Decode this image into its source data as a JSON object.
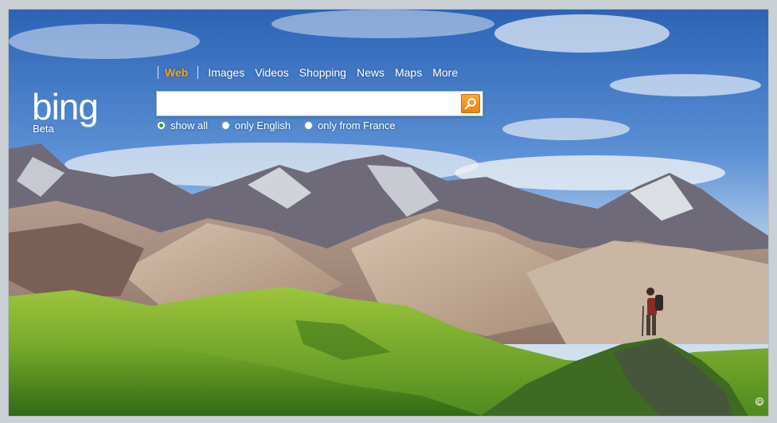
{
  "nav": {
    "items": [
      {
        "label": "Web",
        "active": true
      },
      {
        "label": "Images"
      },
      {
        "label": "Videos"
      },
      {
        "label": "Shopping"
      },
      {
        "label": "News"
      },
      {
        "label": "Maps"
      },
      {
        "label": "More"
      }
    ]
  },
  "logo": {
    "text": "bing",
    "beta_label": "Beta"
  },
  "search": {
    "value": "",
    "placeholder": "",
    "button_icon": "magnifier-icon"
  },
  "options": [
    {
      "label": "show all",
      "checked": true
    },
    {
      "label": "only English",
      "checked": false
    },
    {
      "label": "only from France",
      "checked": false
    }
  ],
  "footer": {
    "copyright_symbol": "©"
  },
  "colors": {
    "accent": "#f1a21e",
    "search_button": "#e9820c",
    "radio_checked": "#3a9b2a"
  }
}
